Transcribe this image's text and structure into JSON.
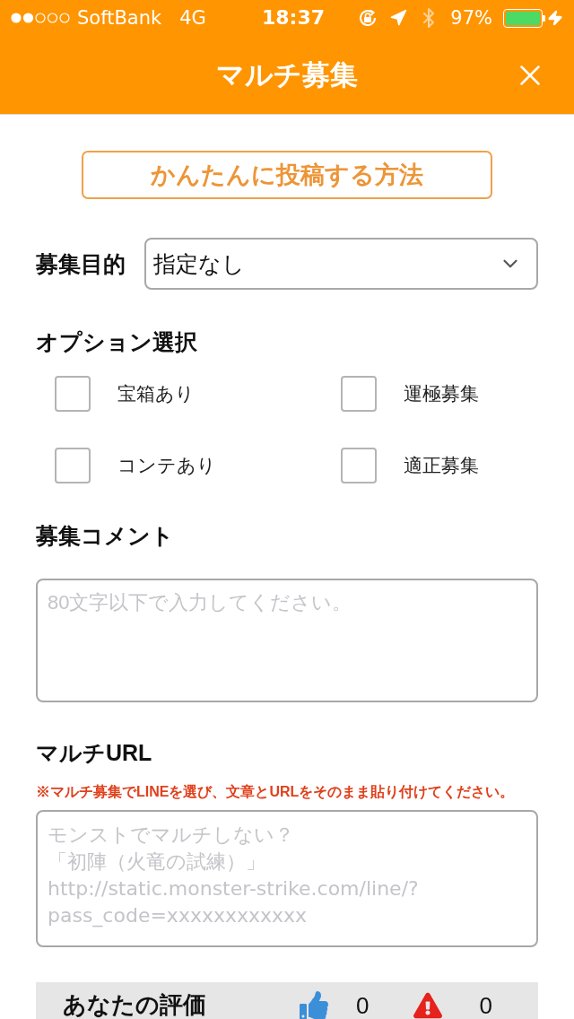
{
  "status_bar": {
    "carrier": "SoftBank",
    "network": "4G",
    "time": "18:37",
    "battery": "97%",
    "charging": true
  },
  "header": {
    "title": "マルチ募集"
  },
  "help_button": {
    "label": "かんたんに投稿する方法"
  },
  "purpose": {
    "label": "募集目的",
    "value": "指定なし"
  },
  "options": {
    "title": "オプション選択",
    "items": [
      {
        "label": "宝箱あり",
        "checked": false
      },
      {
        "label": "運極募集",
        "checked": false
      },
      {
        "label": "コンテあり",
        "checked": false
      },
      {
        "label": "適正募集",
        "checked": false
      }
    ]
  },
  "comment": {
    "title": "募集コメント",
    "placeholder": "80文字以下で入力してください。"
  },
  "multi_url": {
    "title": "マルチURL",
    "note": "※マルチ募集でLINEを選び、文章とURLをそのまま貼り付けてください。",
    "placeholder": [
      "モンストでマルチしない？",
      "「初陣（火竜の試練）」",
      "http://static.monster-strike.com/line/?",
      "pass_code=xxxxxxxxxxxx"
    ]
  },
  "rating": {
    "title": "あなたの評価",
    "items": [
      {
        "kind": "like",
        "count": "0"
      },
      {
        "kind": "report",
        "count": "0"
      }
    ]
  }
}
